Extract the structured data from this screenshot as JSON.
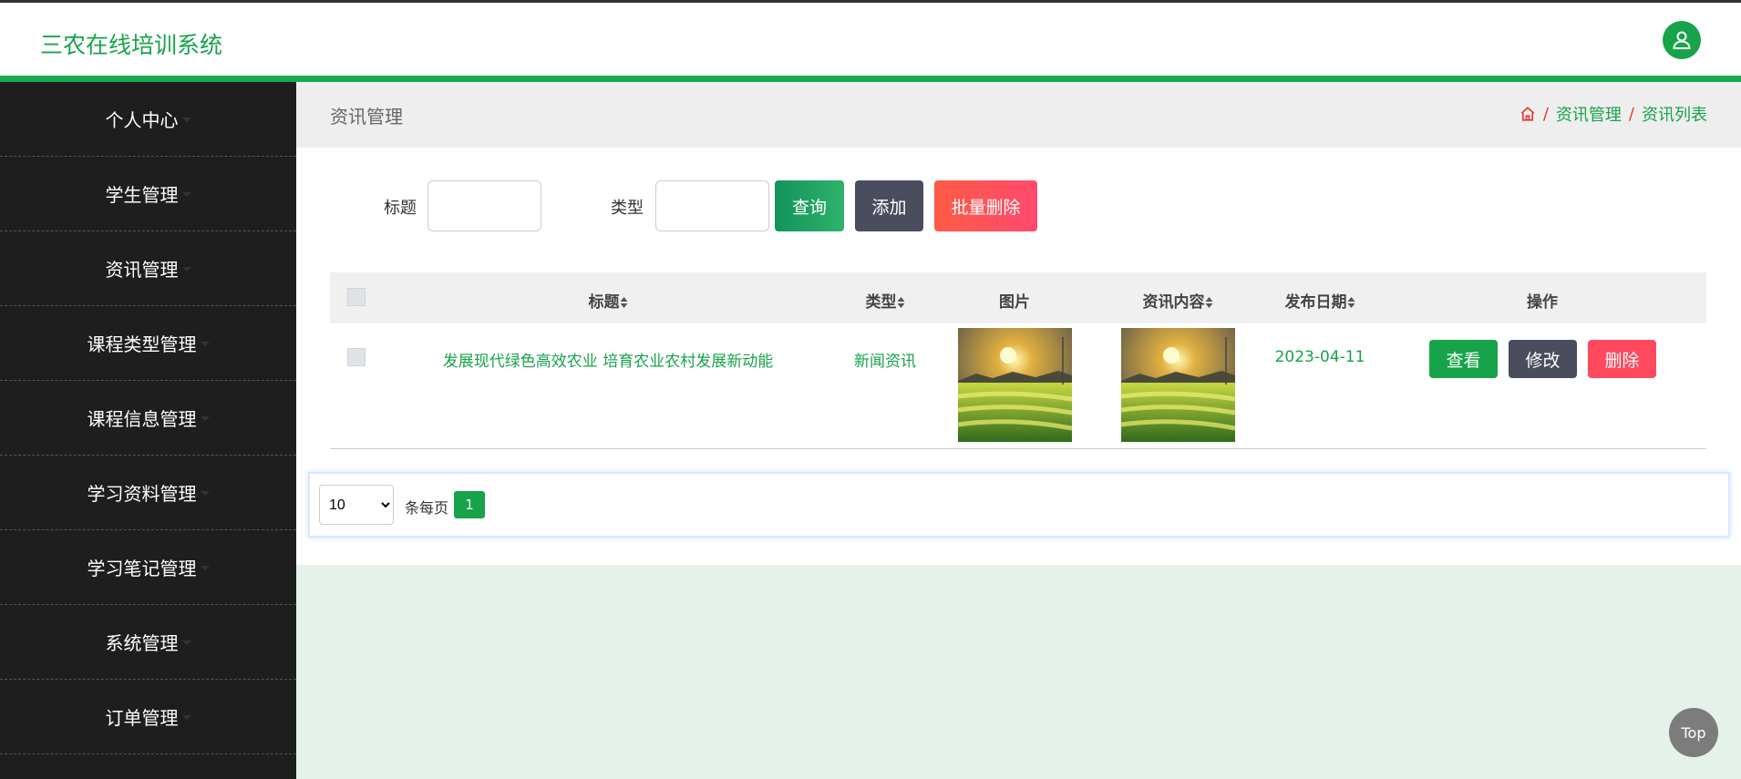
{
  "app": {
    "title": "三农在线培训系统"
  },
  "sidebar": {
    "items": [
      {
        "label": "个人中心"
      },
      {
        "label": "学生管理"
      },
      {
        "label": "资讯管理"
      },
      {
        "label": "课程类型管理"
      },
      {
        "label": "课程信息管理"
      },
      {
        "label": "学习资料管理"
      },
      {
        "label": "学习笔记管理"
      },
      {
        "label": "系统管理"
      },
      {
        "label": "订单管理"
      }
    ]
  },
  "header": {
    "page_title": "资讯管理",
    "breadcrumb": {
      "sep": "/",
      "level1": "资讯管理",
      "level2": "资讯列表"
    }
  },
  "search": {
    "title_label": "标题",
    "title_value": "",
    "type_label": "类型",
    "type_value": "",
    "query_label": "查询",
    "add_label": "添加",
    "bulk_delete_label": "批量删除"
  },
  "table": {
    "columns": [
      "标题",
      "类型",
      "图片",
      "资讯内容",
      "发布日期",
      "操作"
    ],
    "rows": [
      {
        "title": "发展现代绿色高效农业 培育农业农村发展新动能",
        "type": "新闻资讯",
        "date": "2023-04-11",
        "view_label": "查看",
        "edit_label": "修改",
        "delete_label": "删除"
      }
    ]
  },
  "pagination": {
    "page_size": "10",
    "per_page_label": "条每页",
    "current_page": "1"
  },
  "back_to_top": "Top",
  "colors": {
    "brand_green": "#17a34a",
    "sidebar_bg": "#1e1e1e",
    "danger": "#ff4a5e",
    "dark_btn": "#4a4d5e"
  }
}
